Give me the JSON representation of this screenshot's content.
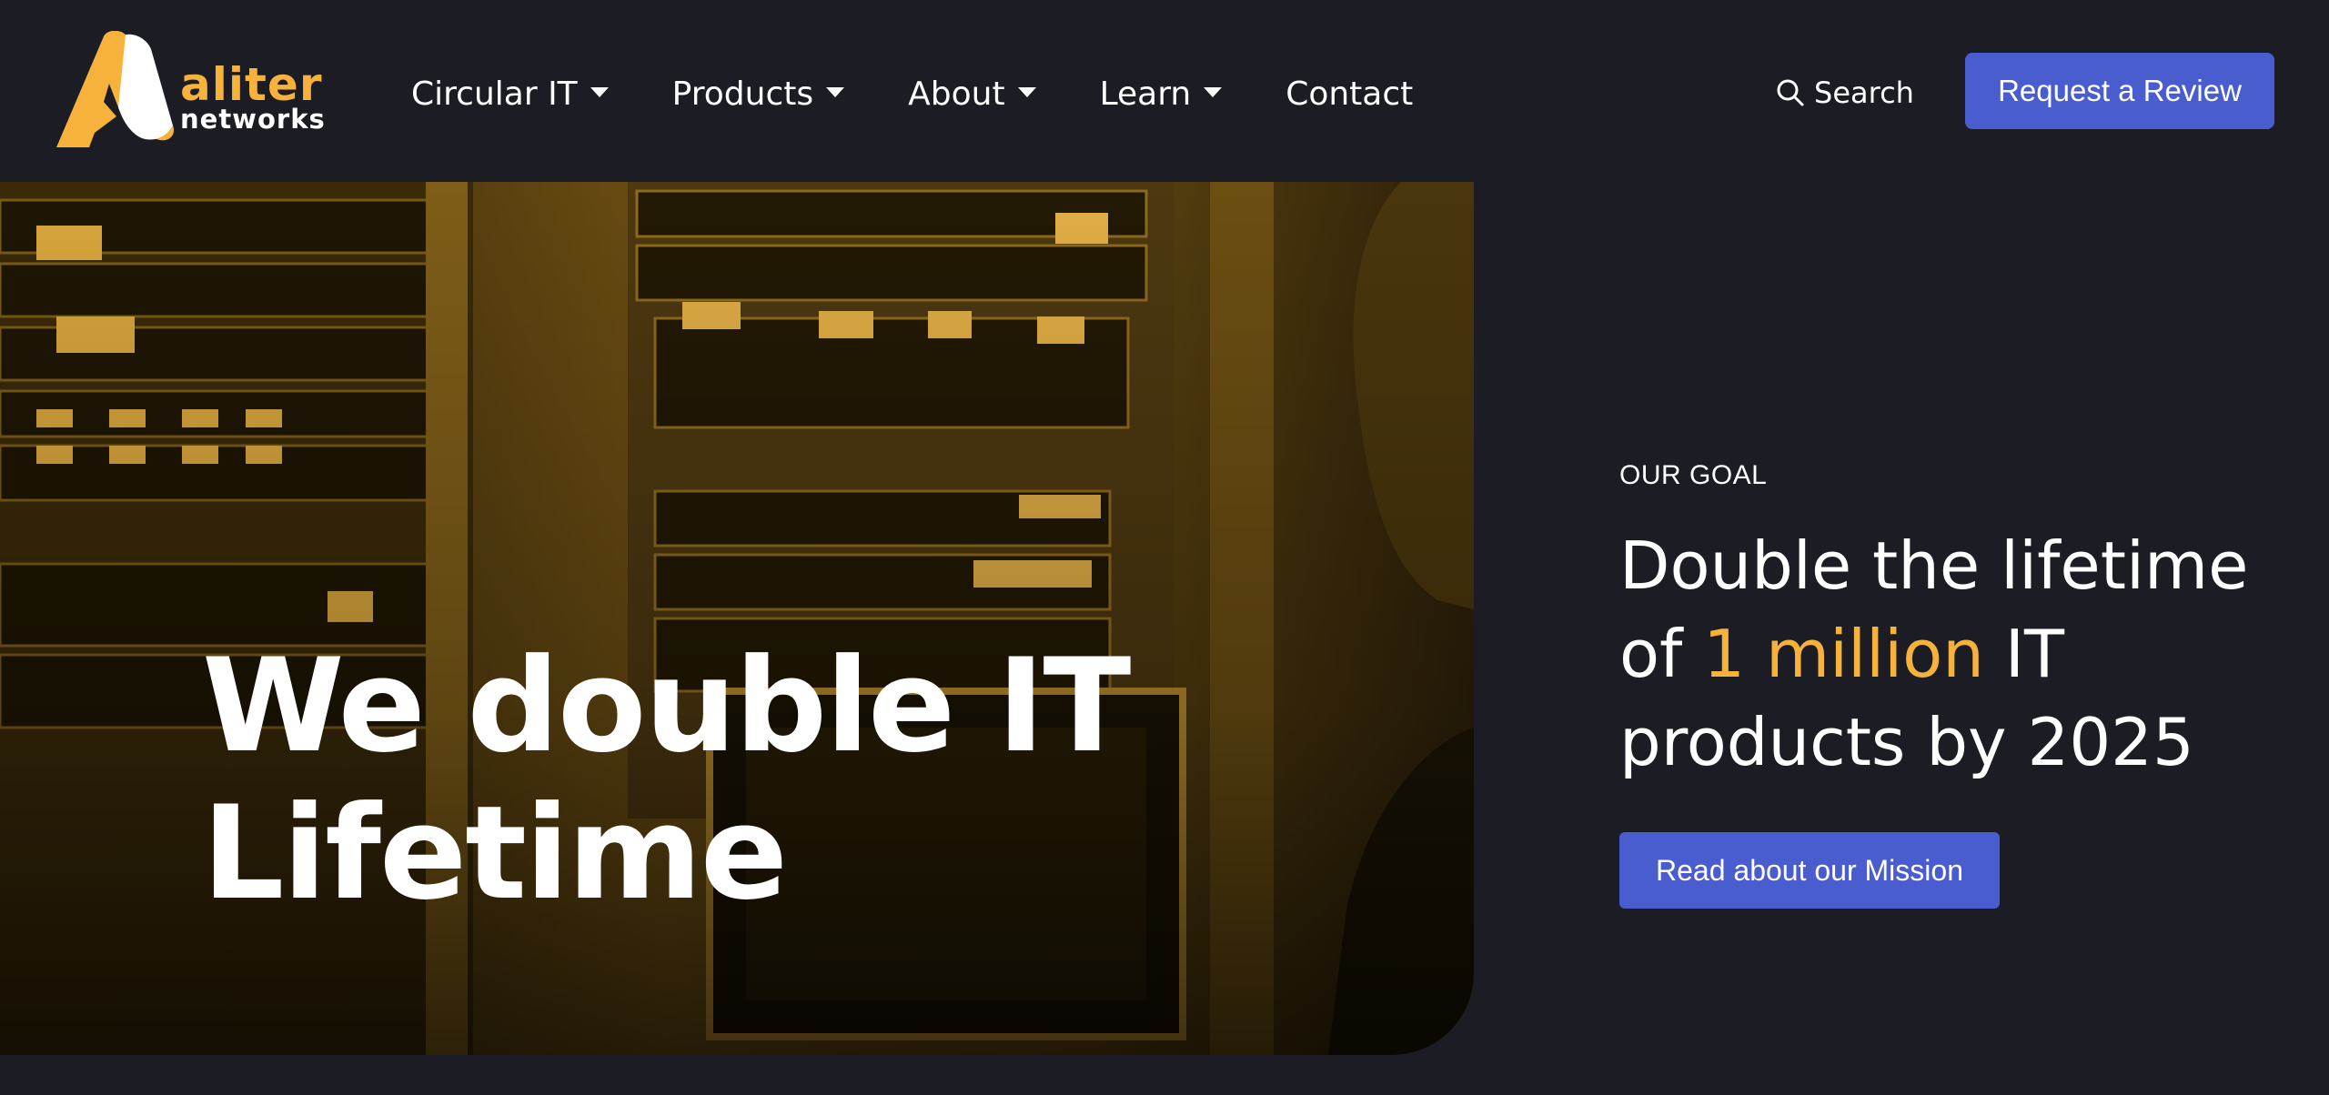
{
  "brand": {
    "name": "aliter",
    "subname": "networks",
    "primary_color": "#f6b23a",
    "accent_color": "#4a5dcf",
    "background_color": "#1c1d24"
  },
  "nav": {
    "items": [
      {
        "label": "Circular IT",
        "dropdown": true
      },
      {
        "label": "Products",
        "dropdown": true
      },
      {
        "label": "About",
        "dropdown": true
      },
      {
        "label": "Learn",
        "dropdown": true
      },
      {
        "label": "Contact",
        "dropdown": false
      }
    ],
    "search_label": "Search",
    "search_icon": "search-icon",
    "cta_label": "Request a Review"
  },
  "hero": {
    "title_line1": "We double IT",
    "title_line2": "Lifetime"
  },
  "goal": {
    "label": "OUR GOAL",
    "heading_part1": "Double the lifetime of ",
    "heading_highlight": "1 million",
    "heading_part2": " IT products by 2025",
    "button_label": "Read about our Mission"
  }
}
